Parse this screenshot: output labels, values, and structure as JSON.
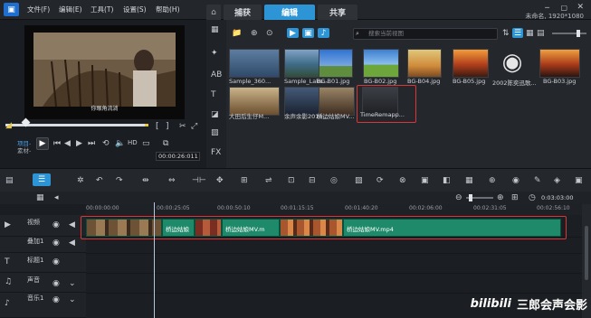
{
  "menu": [
    "文件(F)",
    "编辑(E)",
    "工具(T)",
    "设置(S)",
    "帮助(H)"
  ],
  "workspace_tabs": [
    "捕获",
    "编辑",
    "共享"
  ],
  "active_tab": "编辑",
  "project_info": "未命名, 1920*1080",
  "preview": {
    "subtitle": "你眼角流淌",
    "mode_project": "项目-",
    "mode_clip": "素材-",
    "timecode": "00:00:26:011"
  },
  "library": {
    "search_placeholder": "搜索当前视图",
    "items_row1": [
      {
        "label": "Sample_360...",
        "badge": ""
      },
      {
        "label": "Sample_Lake...",
        "badge": ""
      },
      {
        "label": "BG-B01.jpg",
        "badge": ""
      },
      {
        "label": "BG-B02.jpg",
        "badge": ""
      },
      {
        "label": "BG-B04.jpg",
        "badge": ""
      },
      {
        "label": "BG-B05.jpg",
        "badge": ""
      },
      {
        "label": "2002陈奕迅歌...",
        "badge": ""
      },
      {
        "label": "BG-B03.jpg",
        "badge": ""
      }
    ],
    "items_row2": [
      {
        "label": "大田后生仔M...",
        "badge": ""
      },
      {
        "label": "余声余影2018...",
        "badge": ""
      },
      {
        "label": "桥边姑娘MV...",
        "badge": ""
      },
      {
        "label": "TimeRemapp...",
        "badge": ""
      }
    ]
  },
  "timeline": {
    "ruler": [
      "00:00:00:00",
      "00:00:25:05",
      "00:00:50:10",
      "00:01:15:15",
      "00:01:40:20",
      "00:02:06:00",
      "00:02:31:05",
      "00:02:56:10"
    ],
    "duration": "0:03:03:00",
    "clip_label": "桥边姑娘MV.mp4",
    "clip_label_short": "桥边姑娘",
    "clip_label_mid": "桥边姑娘MV.m",
    "tracks": [
      "视频",
      "叠加1",
      "标题1",
      "声音",
      "音乐1"
    ]
  },
  "watermark": {
    "logo": "bilibili",
    "text": "三郎会声会影"
  },
  "colors": {
    "accent": "#2d95d6",
    "clip": "#1f8a6a",
    "highlight": "#d6383a"
  }
}
